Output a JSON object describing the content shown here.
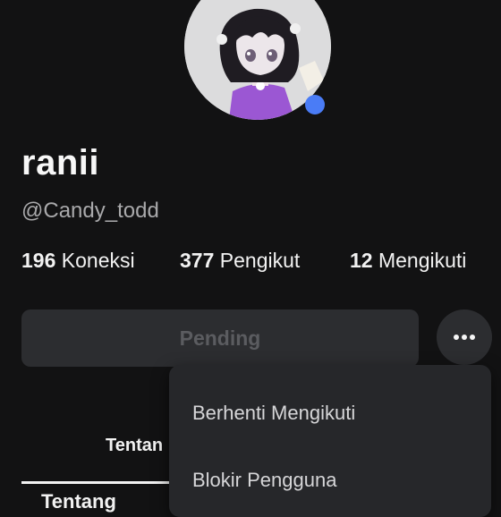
{
  "profile": {
    "display_name": "ranii",
    "username": "@Candy_todd",
    "avatar_icon": "avatar-image",
    "online_indicator_color": "#4a7cf6"
  },
  "stats": {
    "connections_count": "196",
    "connections_label": "Koneksi",
    "followers_count": "377",
    "followers_label": "Pengikut",
    "following_count": "12",
    "following_label": "Mengikuti"
  },
  "actions": {
    "pending_label": "Pending",
    "more_icon": "more-horizontal-icon"
  },
  "tabs": {
    "about_label": "Tentan",
    "section_title": "Tentang"
  },
  "menu": {
    "items": [
      {
        "label": "Berhenti Mengikuti"
      },
      {
        "label": "Blokir Pengguna"
      }
    ]
  }
}
